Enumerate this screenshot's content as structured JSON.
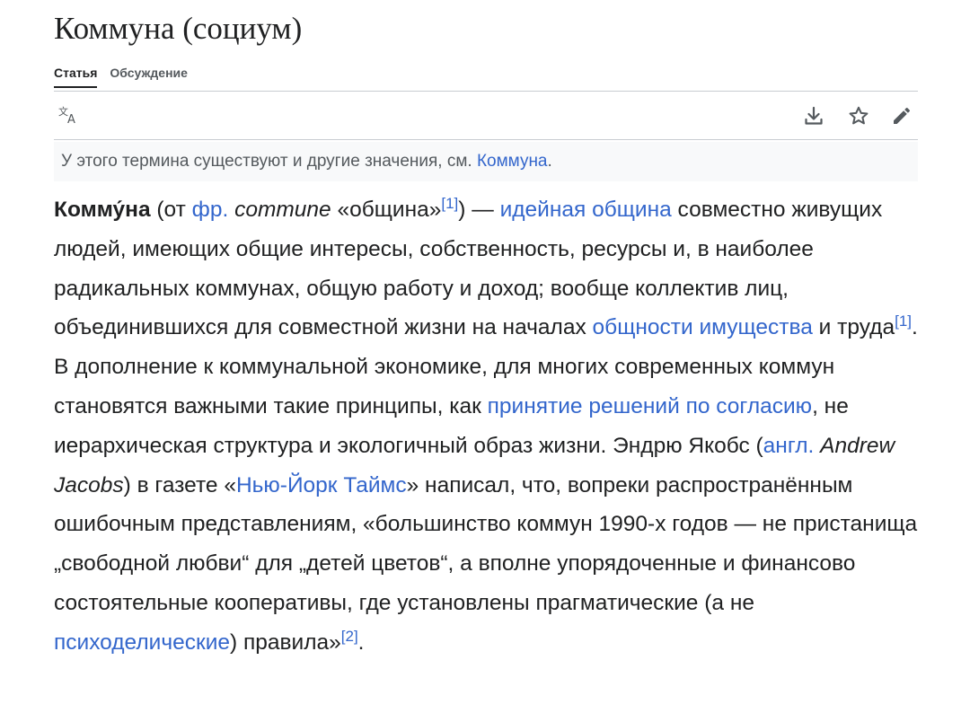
{
  "page": {
    "title": "Коммуна (социум)"
  },
  "tabs": {
    "article": "Статья",
    "talk": "Обсуждение"
  },
  "toolbar": {
    "language_icon": "translate-icon",
    "download_icon": "download-icon",
    "watch_icon": "star-icon",
    "edit_icon": "pencil-icon"
  },
  "hatnote": {
    "text": "У этого термина существуют и другие значения, см. ",
    "link": "Коммуна",
    "end": "."
  },
  "article": {
    "term": "Комму́на",
    "t1": " (от ",
    "l_fr": "фр.",
    "t2": " ",
    "commune": "commune",
    "t3": " «община»",
    "ref1": "[1]",
    "t4": ") — ",
    "l_ideynaya": "идейная община",
    "t5": " совместно живущих людей, имеющих общие интересы, собственность, ресурсы и, в наиболее радикальных коммунах, общую работу и доход; вообще коллектив лиц, объединившихся для совместной жизни на началах ",
    "l_obshnost": "общности имущества",
    "t6": " и труда",
    "ref1b": "[1]",
    "t7": ". В дополнение к коммунальной экономике, для многих современных коммун становятся важными такие принципы, как ",
    "l_consensus": "принятие решений по согласию",
    "t8": ", не иерархическая структура и экологичный образ жизни. Эндрю Якобс (",
    "l_angl": "англ.",
    "t9": " ",
    "andrew": "Andrew Jacobs",
    "t10": ") в газете «",
    "l_nyt": "Нью-Йорк Таймс",
    "t11": "» написал, что, вопреки распространённым ошибочным представлениям, «большинство коммун 1990-х годов — не пристанища „свободной любви“ для „детей цветов“, а вполне упорядоченные и финансово состоятельные кооперативы, где установлены прагматические (а не ",
    "l_psych": "психоделические",
    "t12": ") правила»",
    "ref2": "[2]",
    "t13": "."
  },
  "colors": {
    "link": "#3366cc",
    "text": "#202122",
    "muted": "#54595d",
    "hatnote_bg": "#f8f9fa"
  }
}
